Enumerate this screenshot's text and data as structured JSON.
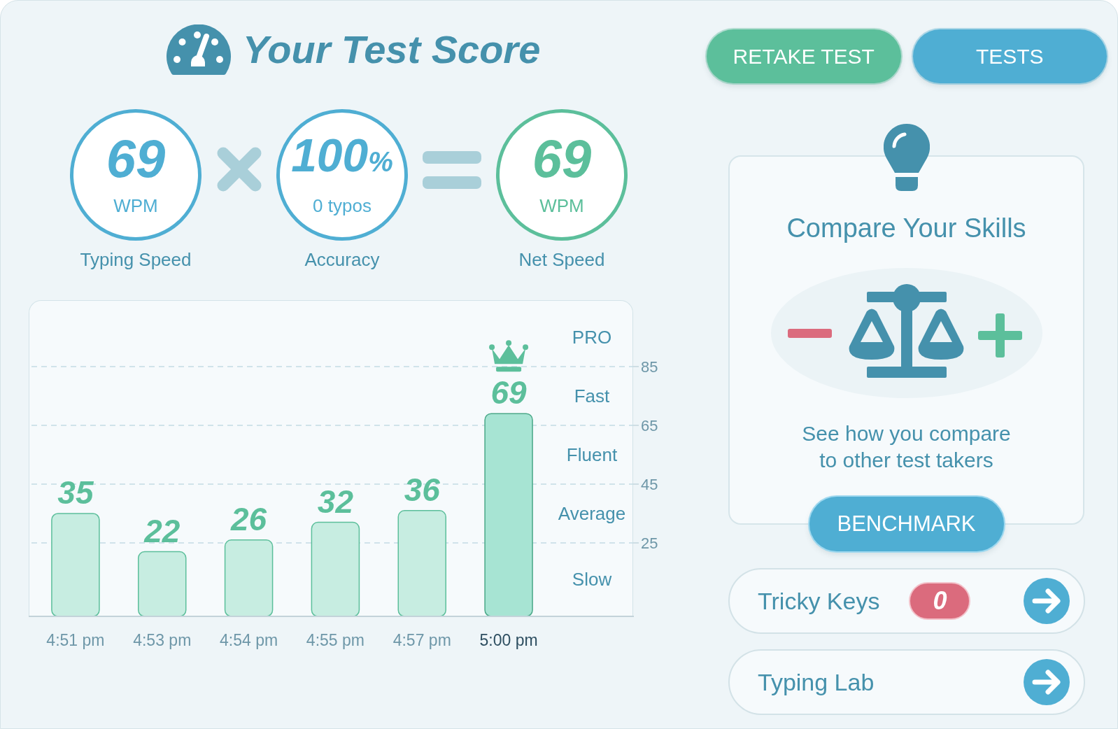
{
  "header": {
    "title": "Your Test Score"
  },
  "actions": [
    {
      "label": "RETAKE TEST",
      "color": "#5cbf9b"
    },
    {
      "label": "TESTS",
      "color": "#4faed3"
    }
  ],
  "formula": [
    {
      "kind": "metric",
      "value": "69",
      "unit": "WPM",
      "caption": "Typing Speed",
      "color": "#4faed3"
    },
    {
      "kind": "times"
    },
    {
      "kind": "metric",
      "value": "100",
      "suffix": "%",
      "unit": "0 typos",
      "caption": "Accuracy",
      "color": "#4faed3"
    },
    {
      "kind": "equals"
    },
    {
      "kind": "metric",
      "value": "69",
      "unit": "WPM",
      "caption": "Net Speed",
      "color": "#5cbf9b"
    }
  ],
  "chart": {
    "speed_bands": [
      "PRO",
      "Fast",
      "Fluent",
      "Average",
      "Slow"
    ],
    "bars": [
      {
        "highlighted": false
      },
      {
        "highlighted": false
      },
      {
        "highlighted": false
      },
      {
        "highlighted": false
      },
      {
        "highlighted": false
      },
      {
        "highlighted": true
      }
    ],
    "chart_data": {
      "type": "bar",
      "categories": [
        "4:51 pm",
        "4:53 pm",
        "4:54 pm",
        "4:55 pm",
        "4:57 pm",
        "5:00 pm"
      ],
      "values": [
        35,
        22,
        26,
        32,
        36,
        69
      ],
      "ylim": [
        0,
        107.6
      ],
      "yticks": [
        25,
        45,
        65,
        85
      ],
      "grid": true,
      "data_labels": true
    }
  },
  "compare_card": {
    "title": "Compare Your Skills",
    "description": "See how you compare to other test takers",
    "button": "BENCHMARK"
  },
  "links": [
    {
      "label": "Tricky Keys",
      "badge": "0"
    },
    {
      "label": "Typing Lab"
    }
  ]
}
